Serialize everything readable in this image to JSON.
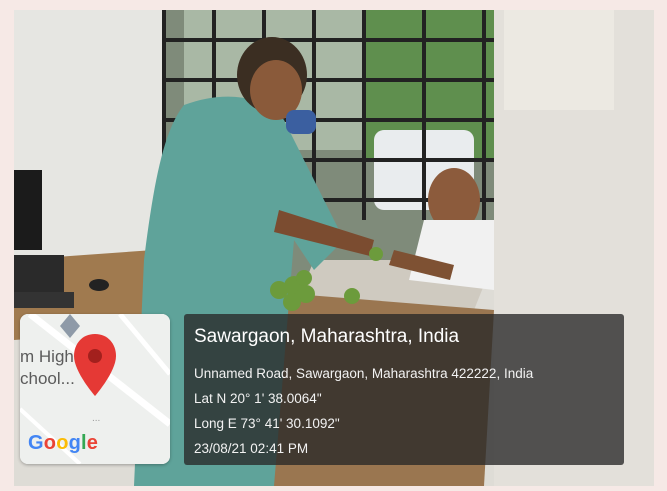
{
  "location": {
    "title": "Sawargaon, Maharashtra, India",
    "address": "Unnamed Road, Sawargaon, Maharashtra 422222, India",
    "latitude": "Lat N 20° 1' 38.0064\"",
    "longitude": "Long E 73° 41' 30.1092\"",
    "datetime": "23/08/21 02:41 PM"
  },
  "map": {
    "place_label": "m High\nchool...",
    "logo_letters": [
      "G",
      "o",
      "o",
      "g",
      "l",
      "e"
    ],
    "logo_colors": [
      "#4285F4",
      "#EA4335",
      "#FBBC05",
      "#4285F4",
      "#34A853",
      "#EA4335"
    ],
    "marker_icon": "map-pin-icon",
    "marker_color": "#E53935"
  },
  "colors": {
    "overlay_bg": "#282828",
    "frame": "#f6e9e6"
  }
}
